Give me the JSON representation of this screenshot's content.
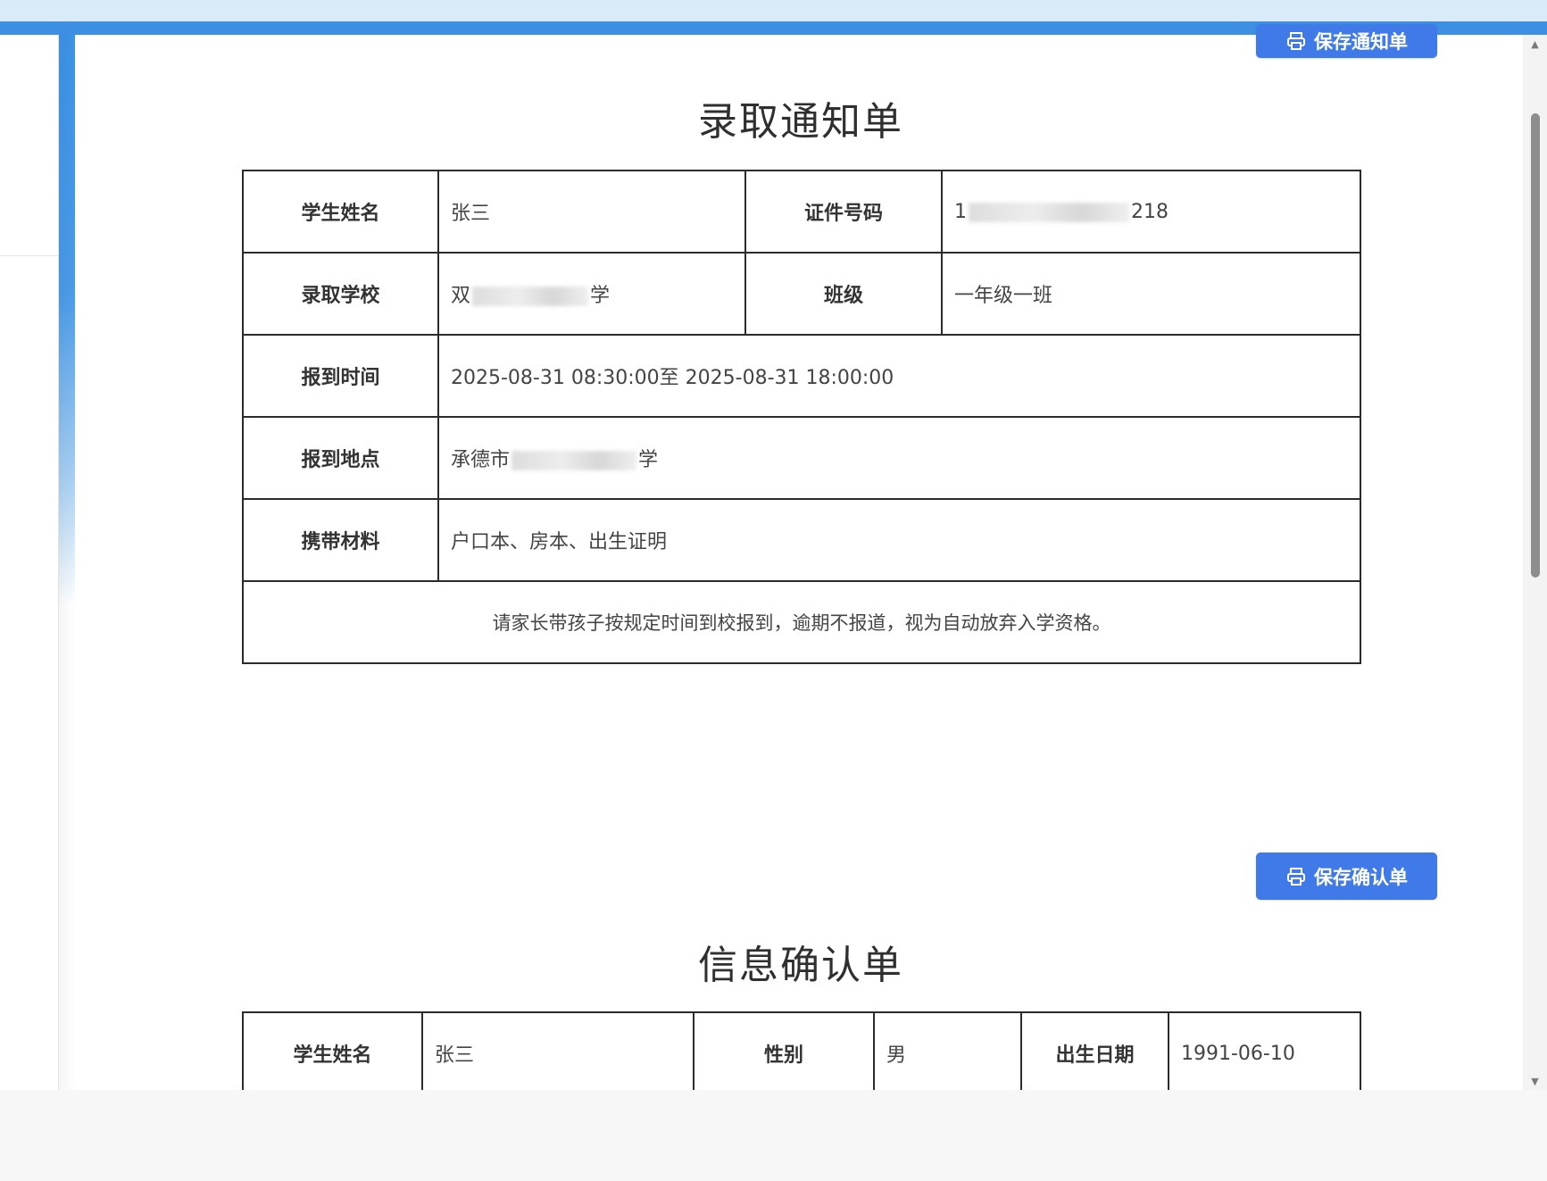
{
  "buttons": {
    "save_notice": "保存通知单",
    "save_confirm": "保存确认单"
  },
  "notice": {
    "title": "录取通知单",
    "student_name_label": "学生姓名",
    "student_name": "张三",
    "id_label": "证件号码",
    "id_prefix": "1",
    "id_suffix": "218",
    "school_label": "录取学校",
    "school_prefix": "双",
    "school_suffix": "学",
    "class_label": "班级",
    "class_value": "一年级一班",
    "time_label": "报到时间",
    "time_value": "2025-08-31 08:30:00至 2025-08-31 18:00:00",
    "location_label": "报到地点",
    "location_prefix": "承德市",
    "location_suffix": "学",
    "materials_label": "携带材料",
    "materials_value": "户口本、房本、出生证明",
    "reminder": "请家长带孩子按规定时间到校报到，逾期不报道，视为自动放弃入学资格。"
  },
  "confirm": {
    "title": "信息确认单",
    "student_name_label": "学生姓名",
    "student_name": "张三",
    "gender_label": "性别",
    "gender_value": "男",
    "birth_label": "出生日期",
    "birth_value": "1991-06-10"
  },
  "icons": {
    "print": "printer-icon"
  },
  "colors": {
    "primary": "#3f7ae8",
    "top_strip": "#3d8fe3",
    "border": "#2b2b2b"
  }
}
